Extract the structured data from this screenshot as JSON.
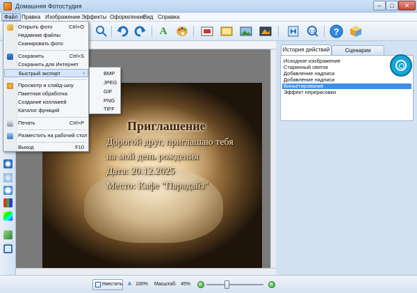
{
  "window": {
    "title": "Домашняя Фотостудия",
    "buttons": {
      "minimize": "–",
      "maximize": "□",
      "close": "✕"
    }
  },
  "menubar": {
    "items": [
      "Файл",
      "Правка",
      "Изображение",
      "Эффекты",
      "Оформление",
      "Вид",
      "Справка"
    ]
  },
  "toolbar": {
    "icons": [
      "crop-icon",
      "undo-icon",
      "redo-icon",
      "text-icon",
      "palette-icon",
      "frame-icon",
      "collage-icon",
      "image-icon",
      "adjust-icon",
      "fit-icon",
      "actual-size-icon",
      "help-icon",
      "box-icon"
    ]
  },
  "file_menu": {
    "items": [
      {
        "label": "Открыть фото",
        "shortcut": "Ctrl+O",
        "icon": "open-folder-icon"
      },
      {
        "label": "Недавние файлы",
        "shortcut": "",
        "icon": ""
      },
      {
        "label": "Сканировать фото",
        "shortcut": "",
        "icon": ""
      },
      {
        "label": "Сохранить",
        "shortcut": "Ctrl+S",
        "icon": "save-icon"
      },
      {
        "label": "Сохранить для Интернет",
        "shortcut": "",
        "icon": ""
      },
      {
        "label": "Быстрый экспорт",
        "shortcut": "",
        "icon": "",
        "submenu": true
      },
      {
        "label": "Просмотр и слайд-шоу",
        "shortcut": "",
        "icon": "slideshow-icon"
      },
      {
        "label": "Пакетная обработка",
        "shortcut": "",
        "icon": ""
      },
      {
        "label": "Создание коллажей",
        "shortcut": "",
        "icon": ""
      },
      {
        "label": "Каталог функций",
        "shortcut": "",
        "icon": ""
      },
      {
        "label": "Печать",
        "shortcut": "Ctrl+P",
        "icon": "print-icon"
      },
      {
        "label": "Разместить на рабочий стол",
        "shortcut": "",
        "icon": "desktop-icon"
      },
      {
        "label": "Выход",
        "shortcut": "F10",
        "icon": ""
      }
    ],
    "submenu_arrow": "›"
  },
  "export_submenu": {
    "items": [
      "BMP",
      "JPEG",
      "GIF",
      "PNG",
      "TIFF"
    ]
  },
  "photo": {
    "lines": [
      "Приглашение",
      "Дорогой друг, приглашаю тебя",
      "на мой день рождения",
      "Дата: 20.12.2025",
      "Место: Кафе \"Парадайз\""
    ]
  },
  "history_panel": {
    "tabs": [
      "История действий",
      "Сценарии"
    ],
    "items": [
      "Исходное изображение",
      "Старинный свиток",
      "Добавление надписи",
      "Добавление надписи",
      "Виньетирование",
      "Эффект перерисовки"
    ],
    "selected_index": 4
  },
  "statusbar": {
    "fit_label": "Уместить",
    "actual_label": "100%",
    "scale_label": "Масштаб:",
    "scale_value": "45%",
    "zoom_fraction": 0.45
  },
  "colors": {
    "selection": "#3d8ee6",
    "accent_float_button": "#12a7d8"
  }
}
